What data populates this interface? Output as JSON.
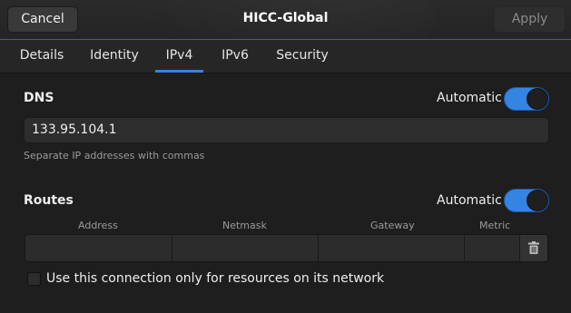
{
  "window": {
    "title": "HICC-Global",
    "cancel_label": "Cancel",
    "apply_label": "Apply"
  },
  "tabs": [
    {
      "label": "Details",
      "active": false
    },
    {
      "label": "Identity",
      "active": false
    },
    {
      "label": "IPv4",
      "active": true
    },
    {
      "label": "IPv6",
      "active": false
    },
    {
      "label": "Security",
      "active": false
    }
  ],
  "dns": {
    "heading": "DNS",
    "automatic_label": "Automatic",
    "automatic_on": true,
    "value": "133.95.104.1",
    "hint": "Separate IP addresses with commas"
  },
  "routes": {
    "heading": "Routes",
    "automatic_label": "Automatic",
    "automatic_on": true,
    "columns": [
      "Address",
      "Netmask",
      "Gateway",
      "Metric"
    ],
    "rows": [
      {
        "address": "",
        "netmask": "",
        "gateway": "",
        "metric": ""
      }
    ]
  },
  "only_local": {
    "label": "Use this connection only for resources on its network",
    "checked": false
  },
  "icons": {
    "delete": "trash-icon"
  },
  "colors": {
    "accent": "#3584e4",
    "background": "#1e1e1e",
    "header": "#262626"
  }
}
